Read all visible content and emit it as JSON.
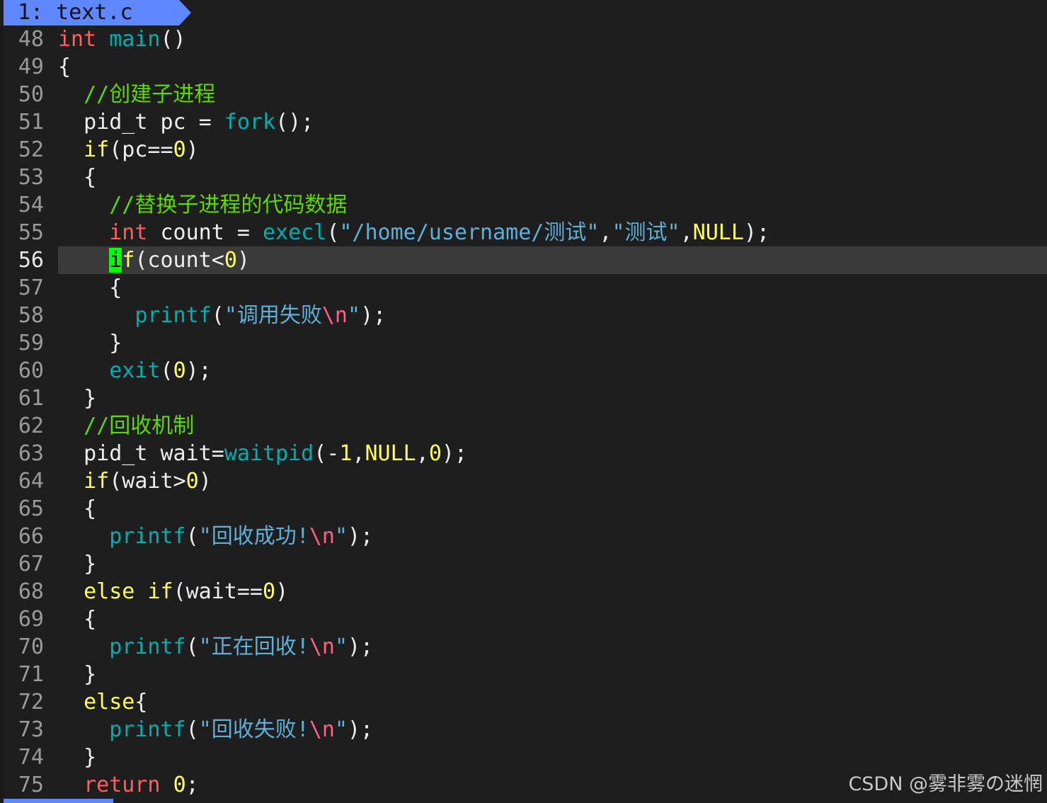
{
  "tabline": {
    "buffer_label": "1: text.c"
  },
  "watermark": "CSDN @雾非雾の迷惘",
  "current_line": 56,
  "colors": {
    "background": "#1e1e1e",
    "tab_background": "#5f87ff",
    "type_keyword": "#ff5f5f",
    "control_keyword": "#ffff5f",
    "function": "#00afaf",
    "string": "#5fafd7",
    "escape": "#ff5f87",
    "comment": "#5fd700",
    "cursor": "#00ff00"
  },
  "lines": [
    {
      "n": "48",
      "tokens": [
        {
          "t": "int",
          "c": "kw"
        },
        {
          "t": " "
        },
        {
          "t": "main",
          "c": "fn"
        },
        {
          "t": "()"
        }
      ]
    },
    {
      "n": "49",
      "tokens": [
        {
          "t": "{"
        }
      ]
    },
    {
      "n": "50",
      "tokens": [
        {
          "t": "  "
        },
        {
          "t": "//创建子进程",
          "c": "cmt"
        }
      ]
    },
    {
      "n": "51",
      "tokens": [
        {
          "t": "  pid_t pc = "
        },
        {
          "t": "fork",
          "c": "fn"
        },
        {
          "t": "();"
        }
      ]
    },
    {
      "n": "52",
      "tokens": [
        {
          "t": "  "
        },
        {
          "t": "if",
          "c": "ctl"
        },
        {
          "t": "(pc=="
        },
        {
          "t": "0",
          "c": "num"
        },
        {
          "t": ")"
        }
      ]
    },
    {
      "n": "53",
      "tokens": [
        {
          "t": "  {"
        }
      ]
    },
    {
      "n": "54",
      "tokens": [
        {
          "t": "    "
        },
        {
          "t": "//替换子进程的代码数据",
          "c": "cmt"
        }
      ]
    },
    {
      "n": "55",
      "tokens": [
        {
          "t": "    "
        },
        {
          "t": "int",
          "c": "kw"
        },
        {
          "t": " count = "
        },
        {
          "t": "execl",
          "c": "fn"
        },
        {
          "t": "("
        },
        {
          "t": "\"/home/username/测试\"",
          "c": "str"
        },
        {
          "t": ","
        },
        {
          "t": "\"测试\"",
          "c": "str"
        },
        {
          "t": ","
        },
        {
          "t": "NULL",
          "c": "ctl"
        },
        {
          "t": ");"
        }
      ]
    },
    {
      "n": "56",
      "tokens": [
        {
          "t": "    "
        },
        {
          "t": "i",
          "c": "cur"
        },
        {
          "t": "f",
          "c": "ctl"
        },
        {
          "t": "(count<"
        },
        {
          "t": "0",
          "c": "num"
        },
        {
          "t": ")"
        }
      ]
    },
    {
      "n": "57",
      "tokens": [
        {
          "t": "    {"
        }
      ]
    },
    {
      "n": "58",
      "tokens": [
        {
          "t": "      "
        },
        {
          "t": "printf",
          "c": "fn"
        },
        {
          "t": "("
        },
        {
          "t": "\"调用失败",
          "c": "str"
        },
        {
          "t": "\\n",
          "c": "esc"
        },
        {
          "t": "\"",
          "c": "str"
        },
        {
          "t": ");"
        }
      ]
    },
    {
      "n": "59",
      "tokens": [
        {
          "t": "    }"
        }
      ]
    },
    {
      "n": "60",
      "tokens": [
        {
          "t": "    "
        },
        {
          "t": "exit",
          "c": "fn"
        },
        {
          "t": "("
        },
        {
          "t": "0",
          "c": "num"
        },
        {
          "t": ");"
        }
      ]
    },
    {
      "n": "61",
      "tokens": [
        {
          "t": "  }"
        }
      ]
    },
    {
      "n": "62",
      "tokens": [
        {
          "t": "  "
        },
        {
          "t": "//回收机制",
          "c": "cmt"
        }
      ]
    },
    {
      "n": "63",
      "tokens": [
        {
          "t": "  pid_t wait="
        },
        {
          "t": "waitpid",
          "c": "fn"
        },
        {
          "t": "(-"
        },
        {
          "t": "1",
          "c": "num"
        },
        {
          "t": ","
        },
        {
          "t": "NULL",
          "c": "ctl"
        },
        {
          "t": ","
        },
        {
          "t": "0",
          "c": "num"
        },
        {
          "t": ");"
        }
      ]
    },
    {
      "n": "64",
      "tokens": [
        {
          "t": "  "
        },
        {
          "t": "if",
          "c": "ctl"
        },
        {
          "t": "(wait>"
        },
        {
          "t": "0",
          "c": "num"
        },
        {
          "t": ")"
        }
      ]
    },
    {
      "n": "65",
      "tokens": [
        {
          "t": "  {"
        }
      ]
    },
    {
      "n": "66",
      "tokens": [
        {
          "t": "    "
        },
        {
          "t": "printf",
          "c": "fn"
        },
        {
          "t": "("
        },
        {
          "t": "\"回收成功!",
          "c": "str"
        },
        {
          "t": "\\n",
          "c": "esc"
        },
        {
          "t": "\"",
          "c": "str"
        },
        {
          "t": ");"
        }
      ]
    },
    {
      "n": "67",
      "tokens": [
        {
          "t": "  }"
        }
      ]
    },
    {
      "n": "68",
      "tokens": [
        {
          "t": "  "
        },
        {
          "t": "else",
          "c": "ctl"
        },
        {
          "t": " "
        },
        {
          "t": "if",
          "c": "ctl"
        },
        {
          "t": "(wait=="
        },
        {
          "t": "0",
          "c": "num"
        },
        {
          "t": ")"
        }
      ]
    },
    {
      "n": "69",
      "tokens": [
        {
          "t": "  {"
        }
      ]
    },
    {
      "n": "70",
      "tokens": [
        {
          "t": "    "
        },
        {
          "t": "printf",
          "c": "fn"
        },
        {
          "t": "("
        },
        {
          "t": "\"正在回收!",
          "c": "str"
        },
        {
          "t": "\\n",
          "c": "esc"
        },
        {
          "t": "\"",
          "c": "str"
        },
        {
          "t": ");"
        }
      ]
    },
    {
      "n": "71",
      "tokens": [
        {
          "t": "  }"
        }
      ]
    },
    {
      "n": "72",
      "tokens": [
        {
          "t": "  "
        },
        {
          "t": "else",
          "c": "ctl"
        },
        {
          "t": "{"
        }
      ]
    },
    {
      "n": "73",
      "tokens": [
        {
          "t": "    "
        },
        {
          "t": "printf",
          "c": "fn"
        },
        {
          "t": "("
        },
        {
          "t": "\"回收失败!",
          "c": "str"
        },
        {
          "t": "\\n",
          "c": "esc"
        },
        {
          "t": "\"",
          "c": "str"
        },
        {
          "t": ");"
        }
      ]
    },
    {
      "n": "74",
      "tokens": [
        {
          "t": "  }"
        }
      ]
    },
    {
      "n": "75",
      "tokens": [
        {
          "t": "  "
        },
        {
          "t": "return",
          "c": "kw"
        },
        {
          "t": " "
        },
        {
          "t": "0",
          "c": "num"
        },
        {
          "t": ";"
        }
      ]
    }
  ]
}
